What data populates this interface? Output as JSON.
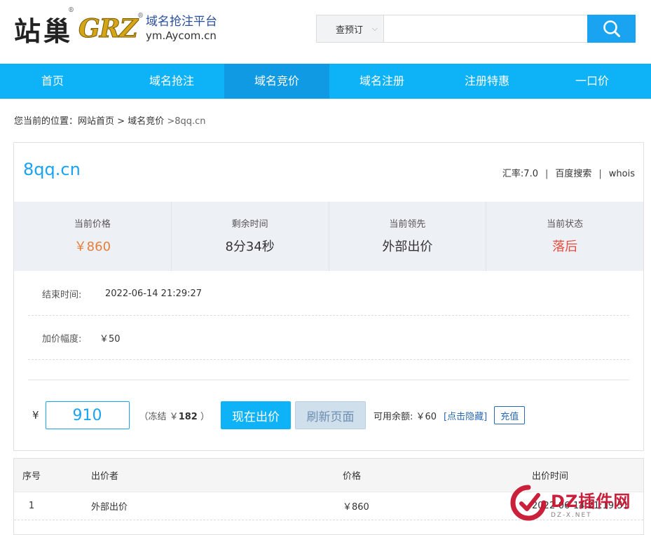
{
  "brand": {
    "name_cn": "站巢",
    "name_en": "GRZ",
    "reg_mark": "®",
    "tagline": "域名抢注平台",
    "site": "ym.Aycom.cn"
  },
  "search": {
    "select_value": "查预订",
    "input_value": "",
    "button_icon": "search-icon"
  },
  "nav": [
    {
      "label": "首页"
    },
    {
      "label": "域名抢注"
    },
    {
      "label": "域名竞价"
    },
    {
      "label": "域名注册"
    },
    {
      "label": "注册特惠"
    },
    {
      "label": "一口价"
    }
  ],
  "nav_active_index": 2,
  "breadcrumb": {
    "prefix": "您当前的位置：",
    "home": "网站首页",
    "sep": " > ",
    "section": "域名竞价",
    "current": " >8qq.cn"
  },
  "domain": {
    "name": "8qq.cn",
    "rate": "汇率:7.0",
    "baidu": "百度搜索",
    "whois": "whois",
    "sep": "|"
  },
  "stats": [
    {
      "label": "当前价格",
      "value": "￥860"
    },
    {
      "label": "剩余时间",
      "value": "8分34秒"
    },
    {
      "label": "当前领先",
      "value": "外部出价"
    },
    {
      "label": "当前状态",
      "value": "落后"
    }
  ],
  "info": {
    "end_label": "结束时间:",
    "end_value": "2022-06-14 21:29:27",
    "step_label": "加价幅度:",
    "step_value": "￥50"
  },
  "bid": {
    "currency": "¥",
    "amount": "910",
    "freeze_prefix": "（冻结 ￥",
    "freeze_amount": "182",
    "freeze_suffix": " ）",
    "bid_button": "现在出价",
    "refresh_button": "刷新页面",
    "available": "可用余额: ￥60",
    "hide_link": "[点击隐藏]",
    "charge_button": "充值"
  },
  "bid_table": {
    "headers": [
      "序号",
      "出价者",
      "价格",
      "出价时间"
    ],
    "rows": [
      [
        "1",
        "外部出价",
        "￥860",
        "2022-06-14 21:19:51"
      ]
    ]
  },
  "watermark": {
    "big": "DZ插件网",
    "small": "DZ-X.NET"
  },
  "colors": {
    "accent": "#0db2f7",
    "price": "#e67e3a",
    "status_bad": "#e84b3c"
  }
}
